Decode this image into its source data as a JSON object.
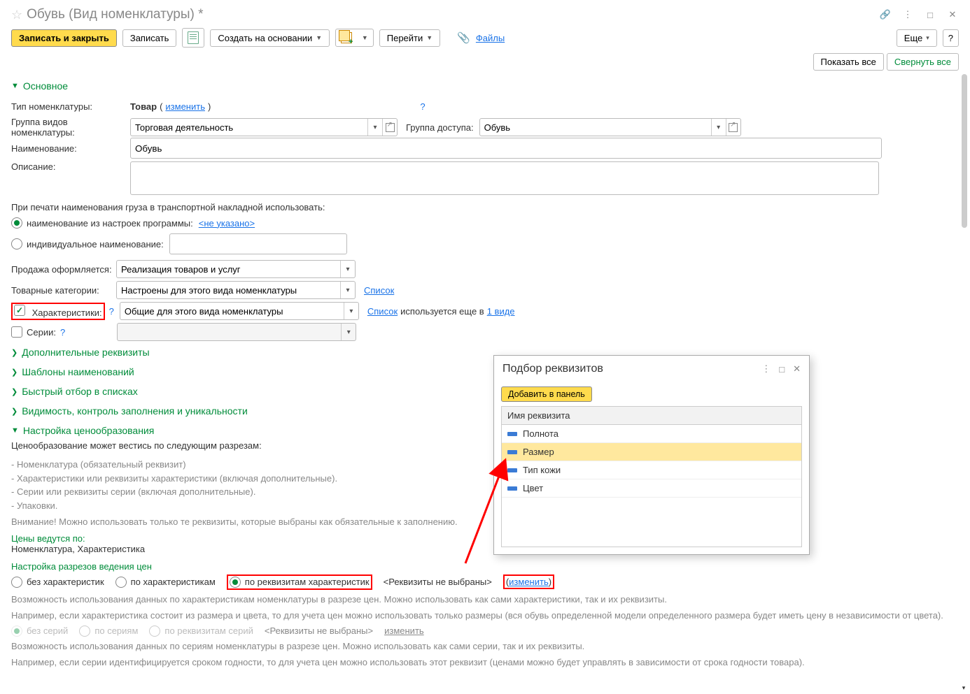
{
  "header": {
    "title": "Обувь (Вид номенклатуры) *"
  },
  "toolbar": {
    "save_close": "Записать и закрыть",
    "save": "Записать",
    "create_based": "Создать на основании",
    "goto": "Перейти",
    "files": "Файлы",
    "more": "Еще"
  },
  "right_buttons": {
    "show_all": "Показать все",
    "collapse_all": "Свернуть все"
  },
  "section_main": "Основное",
  "fields": {
    "type_label": "Тип номенклатуры:",
    "type_value": "Товар",
    "change": "изменить",
    "group_label": "Группа видов номенклатуры:",
    "group_value": "Торговая деятельность",
    "access_label": "Группа доступа:",
    "access_value": "Обувь",
    "name_label": "Наименование:",
    "name_value": "Обувь",
    "desc_label": "Описание:",
    "print_note": "При печати наименования груза в транспортной накладной использовать:",
    "radio1": "наименование из настроек программы:",
    "radio1_val": "<не указано>",
    "radio2": "индивидуальное наименование:",
    "sale_label": "Продажа оформляется:",
    "sale_value": "Реализация товаров и услуг",
    "cat_label": "Товарные категории:",
    "cat_value": "Настроены для этого вида номенклатуры",
    "list": "Список",
    "char_label": "Характеристики:",
    "char_value": "Общие для этого вида номенклатуры",
    "used_in": "используется еще в",
    "one_type": "1 виде",
    "series_label": "Серии:"
  },
  "sections": {
    "s1": "Дополнительные реквизиты",
    "s2": "Шаблоны наименований",
    "s3": "Быстрый отбор в списках",
    "s4": "Видимость, контроль заполнения и уникальности",
    "s5": "Настройка ценообразования"
  },
  "pricing": {
    "intro": "Ценообразование может вестись по следующим разрезам:",
    "b1": "- Номенклатура (обязательный реквизит)",
    "b2": "- Характеристики или реквизиты характеристики (включая дополнительные).",
    "b3": "- Серии или реквизиты серии (включая дополнительные).",
    "b4": "- Упаковки.",
    "warn": "Внимание! Можно использовать только те реквизиты, которые выбраны как обязательные к заполнению.",
    "by_label": "Цены ведутся по:",
    "by_value": "Номенклатура, Характеристика",
    "dim_label": "Настройка разрезов ведения цен",
    "r1": "без характеристик",
    "r2": "по характеристикам",
    "r3": "по реквизитам характеристик",
    "not_selected": "<Реквизиты не выбраны>",
    "note1": "Возможность использования данных по характеристикам номенклатуры в разрезе цен. Можно использовать как сами характеристики, так и их реквизиты.",
    "note2": "Например, если характеристика состоит из размера и цвета, то для учета цен можно использовать только размеры (вся обувь определенной модели определенного размера будет иметь цену в независимости от цвета).",
    "sr1": "без серий",
    "sr2": "по сериям",
    "sr3": "по реквизитам серий",
    "sr_not": "<Реквизиты не выбраны>",
    "sr_change": "изменить",
    "note3": "Возможность использования данных по сериям номенклатуры в разрезе цен. Можно использовать как сами серии, так и их реквизиты.",
    "note4": "Например, если серии идентифицируется сроком годности, то для учета цен можно использовать этот реквизит (ценами можно будет управлять в зависимости от срока годности товара)."
  },
  "dialog": {
    "title": "Подбор реквизитов",
    "add": "Добавить в панель",
    "col": "Имя реквизита",
    "r1": "Полнота",
    "r2": "Размер",
    "r3": "Тип кожи",
    "r4": "Цвет"
  }
}
